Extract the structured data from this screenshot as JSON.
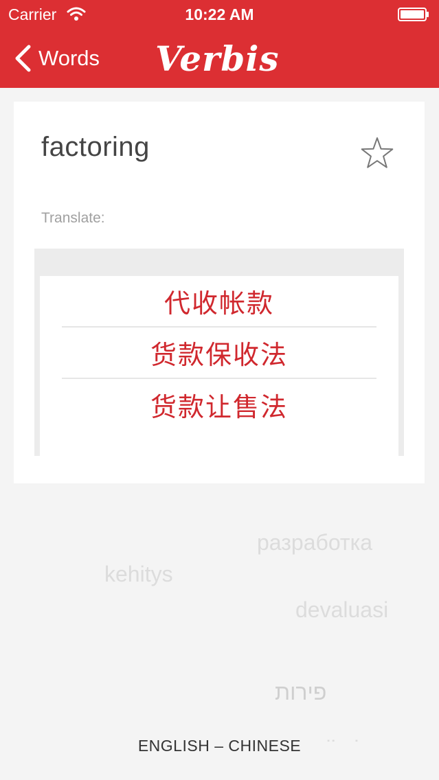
{
  "status_bar": {
    "carrier": "Carrier",
    "time": "10:22 AM",
    "icons": [
      "wifi-icon",
      "battery-icon"
    ]
  },
  "nav": {
    "back_label": "Words",
    "logo_text": "Verbis",
    "back_icon": "chevron-left-icon"
  },
  "card": {
    "word": "factoring",
    "star_icon": "star-outline-icon",
    "translate_label": "Translate:",
    "translations": [
      "代收帐款",
      "货款保收法",
      "货款让售法"
    ]
  },
  "background_words": [
    "разработка",
    "kehitys",
    "devaluasi",
    "פירות",
    "malkeba"
  ],
  "footer": {
    "language_pair": "ENGLISH – CHINESE"
  },
  "colors": {
    "accent": "#dc2f33",
    "translation_text": "#d0282e",
    "background": "#f4f4f4"
  }
}
